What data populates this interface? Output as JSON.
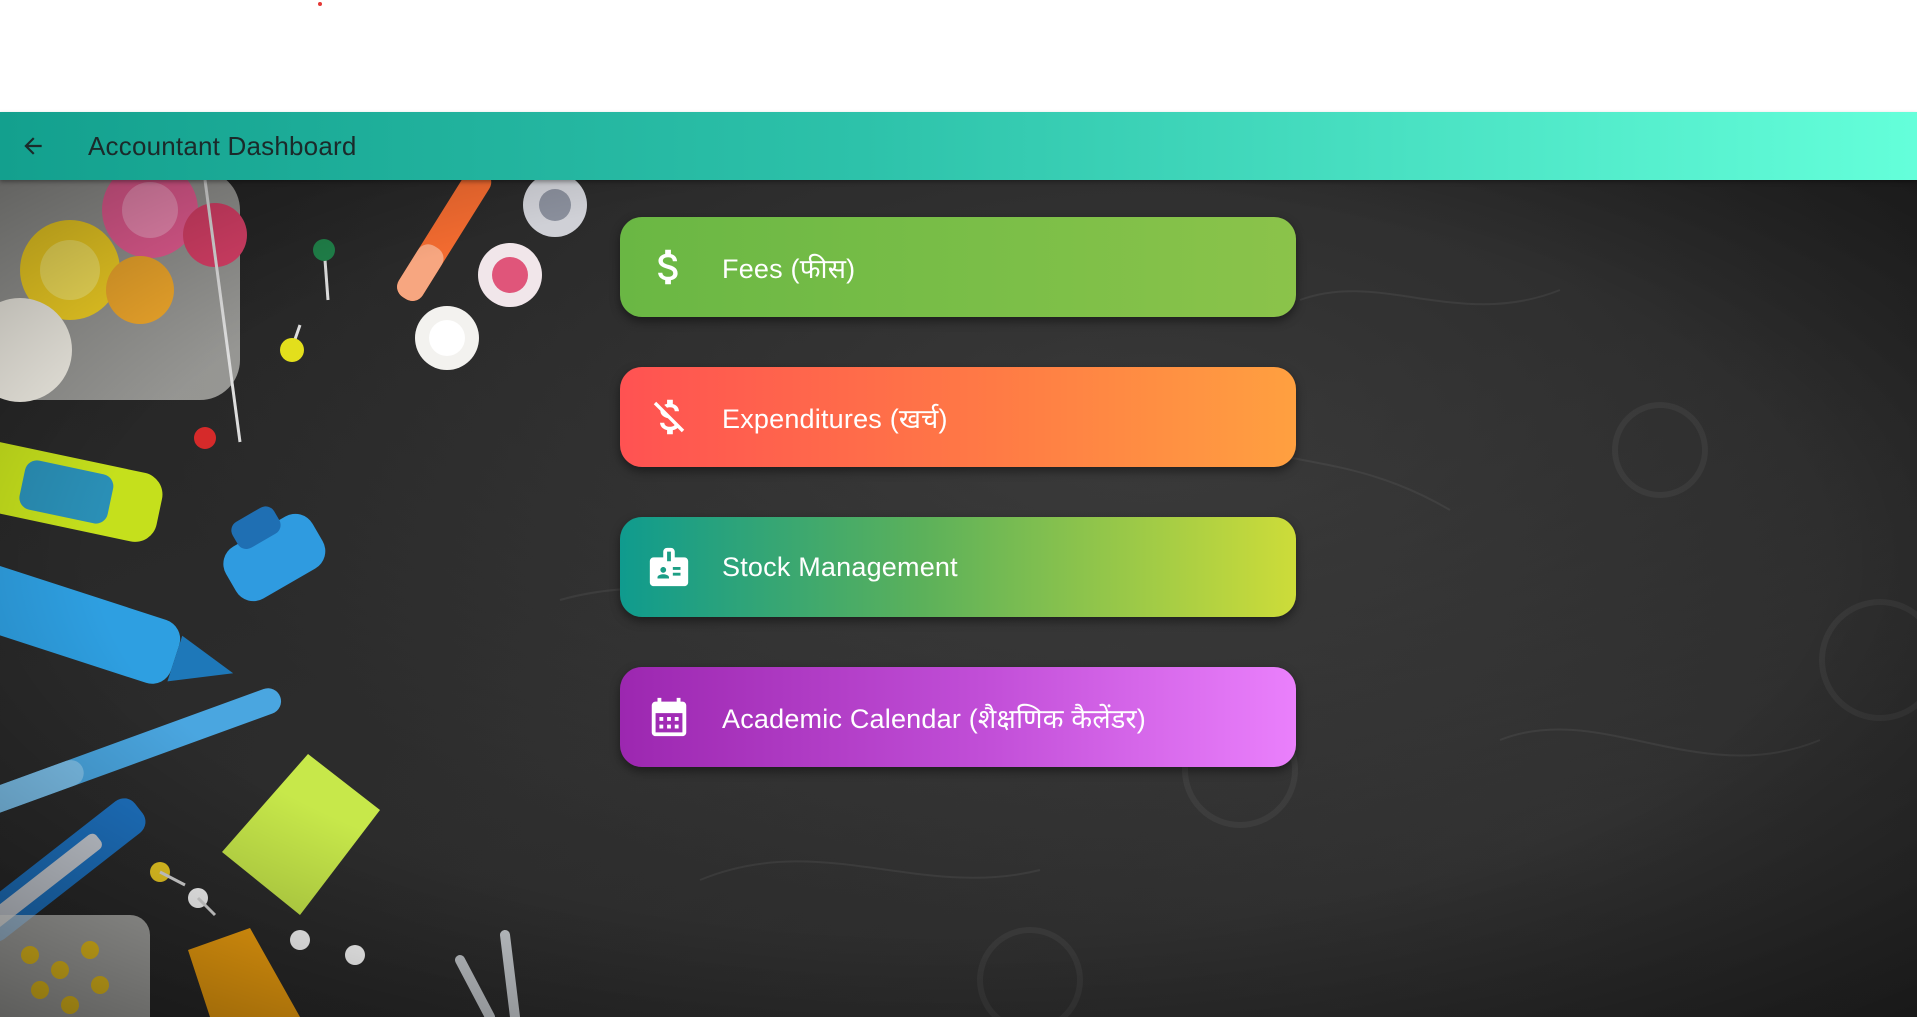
{
  "colors": {
    "app_bar_start": "#13A08E",
    "app_bar_end": "#64FFDA",
    "fees_start": "#6AB744",
    "fees_end": "#8BC34A",
    "expenditures_start": "#FF5252",
    "expenditures_end": "#FFA040",
    "stock_start": "#0F9B8E",
    "stock_end": "#CDDC39",
    "calendar_start": "#9C27B0",
    "calendar_end": "#EA80FC"
  },
  "app_bar": {
    "title": "Accountant Dashboard",
    "back_icon": "arrow-back-icon"
  },
  "menu": [
    {
      "label": "Fees (फीस)",
      "icon": "dollar-icon"
    },
    {
      "label": "Expenditures (खर्च)",
      "icon": "money-off-icon"
    },
    {
      "label": "Stock Management",
      "icon": "badge-icon"
    },
    {
      "label": "Academic Calendar (शैक्षणिक कैलेंडर)",
      "icon": "calendar-icon"
    }
  ]
}
